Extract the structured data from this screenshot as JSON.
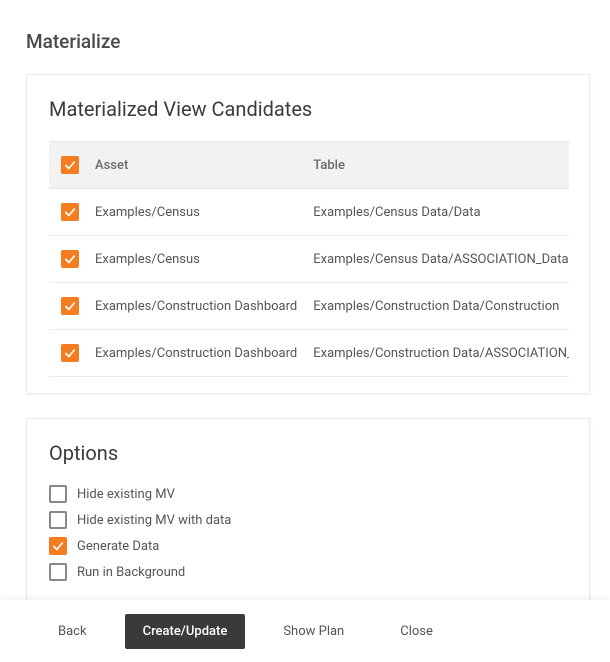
{
  "dialog": {
    "title": "Materialize"
  },
  "candidates": {
    "title": "Materialized View Candidates",
    "columns": {
      "asset": "Asset",
      "table": "Table"
    },
    "header_checked": true,
    "rows": [
      {
        "checked": true,
        "asset": "Examples/Census",
        "table": "Examples/Census Data/Data"
      },
      {
        "checked": true,
        "asset": "Examples/Census",
        "table": "Examples/Census Data/ASSOCIATION_Data"
      },
      {
        "checked": true,
        "asset": "Examples/Construction Dashboard",
        "table": "Examples/Construction Data/Construction"
      },
      {
        "checked": true,
        "asset": "Examples/Construction Dashboard",
        "table": "Examples/Construction Data/ASSOCIATION_Construction"
      }
    ]
  },
  "options": {
    "title": "Options",
    "items": [
      {
        "label": "Hide existing MV",
        "checked": false
      },
      {
        "label": "Hide existing MV with data",
        "checked": false
      },
      {
        "label": "Generate Data",
        "checked": true
      },
      {
        "label": "Run in Background",
        "checked": false
      }
    ]
  },
  "buttons": {
    "back": "Back",
    "create": "Create/Update",
    "showplan": "Show Plan",
    "close": "Close"
  }
}
